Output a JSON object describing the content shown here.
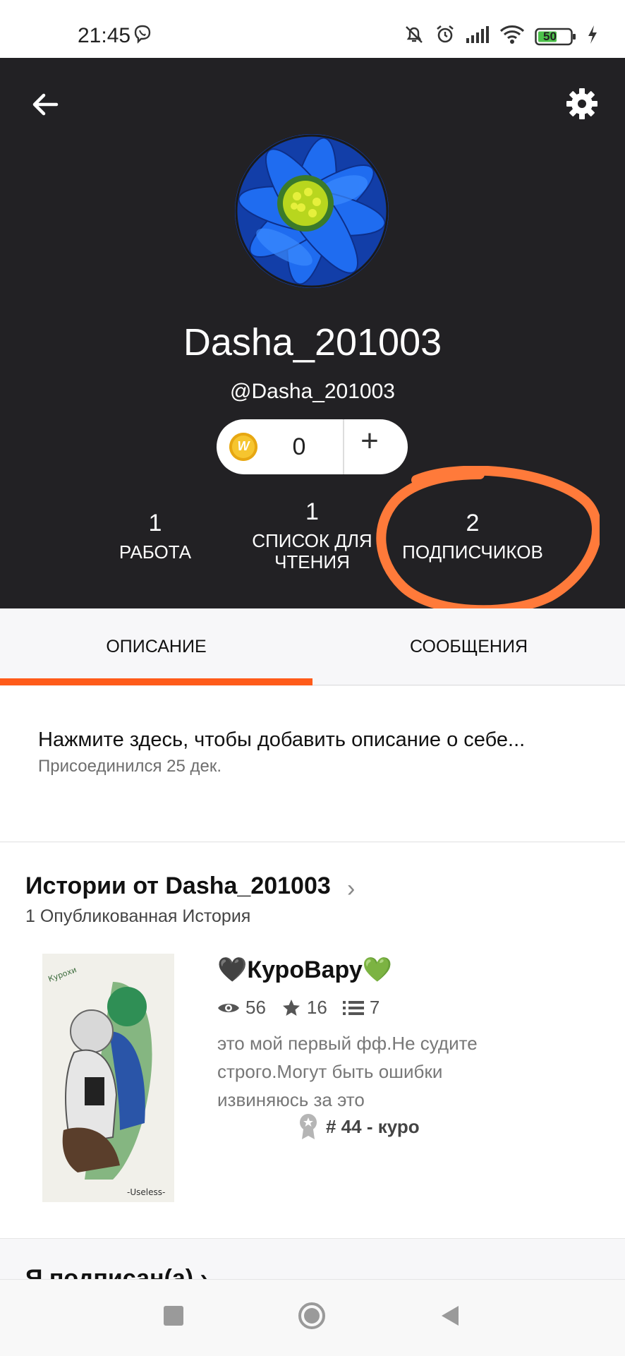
{
  "status_bar": {
    "time": "21:45",
    "battery": "50"
  },
  "profile": {
    "display_name": "Dasha_201003",
    "handle": "@Dasha_201003",
    "coins": "0",
    "add_label": "+"
  },
  "stats": [
    {
      "count": "1",
      "label": "РАБОТА"
    },
    {
      "count": "1",
      "label": "СПИСОК ДЛЯ ЧТЕНИЯ"
    },
    {
      "count": "2",
      "label": "ПОДПИСЧИКОВ"
    }
  ],
  "tabs": [
    {
      "label": "ОПИСАНИЕ",
      "active": true
    },
    {
      "label": "СООБЩЕНИЯ",
      "active": false
    }
  ],
  "about": {
    "description": "Нажмите здесь, чтобы добавить описание о себе...",
    "joined": "Присоединился 25 дек."
  },
  "stories": {
    "title": "Истории от Dasha_201003",
    "subtitle": "1 Опубликованная История",
    "items": [
      {
        "title": "🖤КуроВару💚",
        "views": "56",
        "votes": "16",
        "parts": "7",
        "description": "это мой первый фф.Не судите строго.Могут быть ошибки извиняюсь за это",
        "rank": "# 44 - куро",
        "cover_text": "-Useless-"
      }
    ]
  },
  "following": {
    "title": "Я подписан(а) ›"
  },
  "colors": {
    "accent": "#ff5b1a",
    "header_bg": "#222124",
    "annotation": "#ff7a3a"
  }
}
